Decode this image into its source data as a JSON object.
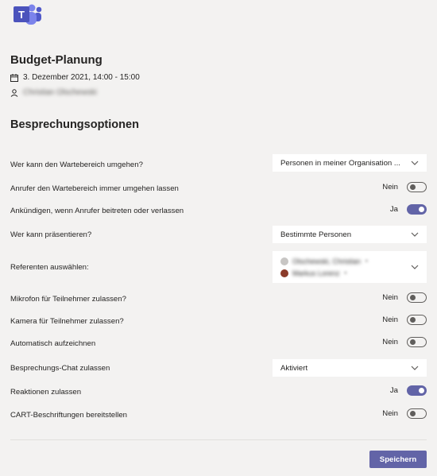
{
  "meeting": {
    "title": "Budget-Planung",
    "datetime": "3. Dezember 2021, 14:00 - 15:00",
    "organizer": "Christian Olschewski"
  },
  "section_title": "Besprechungsoptionen",
  "options": {
    "lobby_bypass": {
      "label": "Wer kann den Wartebereich umgehen?",
      "value": "Personen in meiner Organisation ..."
    },
    "callers_bypass": {
      "label": "Anrufer den Wartebereich immer umgehen lassen",
      "state": "Nein",
      "on": false
    },
    "announce": {
      "label": "Ankündigen, wenn Anrufer beitreten oder verlassen",
      "state": "Ja",
      "on": true
    },
    "presenters": {
      "label": "Wer kann präsentieren?",
      "value": "Bestimmte Personen"
    },
    "select_presenters": {
      "label": "Referenten auswählen:",
      "people": [
        {
          "name": "Olschewski, Christian",
          "remove": "×"
        },
        {
          "name": "Markus Lorenz",
          "remove": "×"
        }
      ]
    },
    "mic": {
      "label": "Mikrofon für Teilnehmer zulassen?",
      "state": "Nein",
      "on": false
    },
    "camera": {
      "label": "Kamera für Teilnehmer zulassen?",
      "state": "Nein",
      "on": false
    },
    "autorecord": {
      "label": "Automatisch aufzeichnen",
      "state": "Nein",
      "on": false
    },
    "chat": {
      "label": "Besprechungs-Chat zulassen",
      "value": "Aktiviert"
    },
    "reactions": {
      "label": "Reaktionen zulassen",
      "state": "Ja",
      "on": true
    },
    "cart": {
      "label": "CART-Beschriftungen bereitstellen",
      "state": "Nein",
      "on": false
    }
  },
  "save_label": "Speichern",
  "colors": {
    "accent": "#6264a7",
    "background": "#f3f2f1"
  },
  "icons": [
    "teams-logo",
    "calendar-icon",
    "person-icon",
    "chevron-down-icon"
  ]
}
